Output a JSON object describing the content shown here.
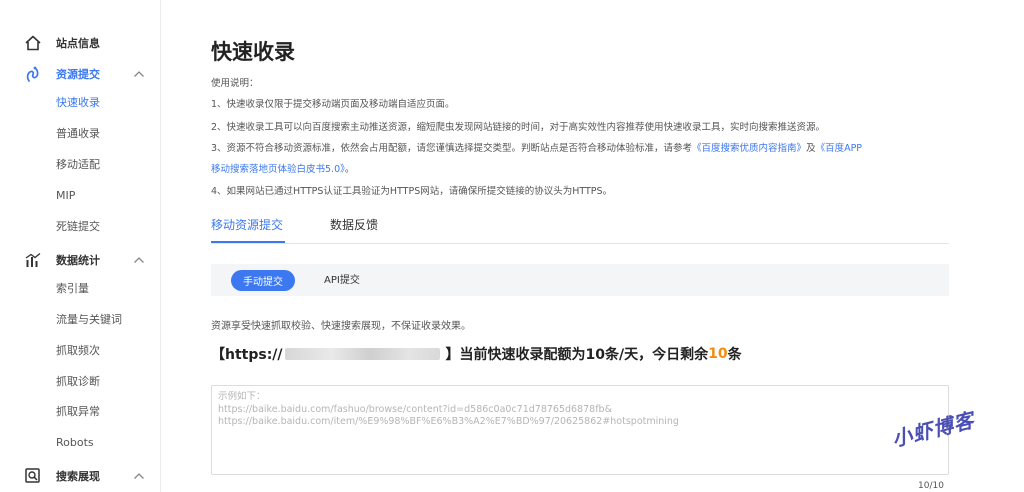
{
  "sidebar": {
    "sections": [
      {
        "label": "站点信息",
        "icon": "home-icon",
        "expanded": false,
        "active": false
      },
      {
        "label": "资源提交",
        "icon": "submit-resource-icon",
        "expanded": true,
        "active": true,
        "items": [
          "快速收录",
          "普通收录",
          "移动适配",
          "MIP",
          "死链提交"
        ],
        "active_item": "快速收录"
      },
      {
        "label": "数据统计",
        "icon": "bar-chart-icon",
        "expanded": true,
        "active": false,
        "items": [
          "索引量",
          "流量与关键词",
          "抓取频次",
          "抓取诊断",
          "抓取异常",
          "Robots"
        ]
      },
      {
        "label": "搜索展现",
        "icon": "search-display-icon",
        "expanded": true,
        "active": false
      }
    ]
  },
  "main": {
    "title": "快速收录",
    "instructions": {
      "heading": "使用说明：",
      "line1": "1、快速收录仅限于提交移动端页面及移动端自适应页面。",
      "line2": "2、快速收录工具可以向百度搜索主动推送资源，缩短爬虫发现网站链接的时间，对于高实效性内容推荐使用快速收录工具，实时向搜索推送资源。",
      "line3_prefix": "3、资源不符合移动资源标准，依然会占用配额，请您谨慎选择提交类型。判断站点是否符合移动体验标准，请参考",
      "line3_link1": "《百度搜索优质内容指南》",
      "line3_mid": "及",
      "line3_link2a": "《百度APP",
      "line3_link2b": "移动搜索落地页体验白皮书5.0》",
      "line3_suffix": "。",
      "line4": "4、如果网站已通过HTTPS认证工具验证为HTTPS网站，请确保所提交链接的协议头为HTTPS。"
    },
    "tabs": [
      "移动资源提交",
      "数据反馈"
    ],
    "active_tab": "移动资源提交",
    "submit_modes": [
      "手动提交",
      "API提交"
    ],
    "active_mode": "手动提交",
    "description": "资源享受快速抓取校验、快速搜索展现，不保证收录效果。",
    "quota": {
      "prefix": "【https://",
      "suffix_before_quota": "】当前快速收录配额为10条/天，今日剩余",
      "remaining": "10",
      "unit": "条"
    },
    "textarea": {
      "placeholder_line1": "示例如下：",
      "placeholder_line2": "https://baike.baidu.com/fashuo/browse/content?id=d586c0a0c71d78765d6878fb&",
      "placeholder_line3": "https://baike.baidu.com/item/%E9%98%BF%E6%B3%A2%E7%BD%97/20625862#hotspotmining"
    },
    "counter": "10/10"
  },
  "watermark": "小虾博客",
  "colors": {
    "accent": "#3c78f0",
    "highlight": "#f28c14",
    "watermark": "#4a4fb3"
  }
}
